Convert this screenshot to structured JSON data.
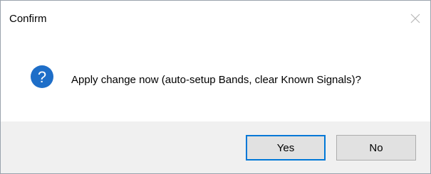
{
  "dialog": {
    "title": "Confirm",
    "message": "Apply change now (auto-setup Bands, clear Known Signals)?",
    "icon": "question-icon",
    "close_icon": "close-icon",
    "buttons": {
      "yes_label": "Yes",
      "no_label": "No"
    },
    "colors": {
      "icon_fill": "#1e6ec8",
      "focus_border": "#0078d7",
      "footer_bg": "#f0f0f0",
      "button_bg": "#e1e1e1"
    }
  }
}
